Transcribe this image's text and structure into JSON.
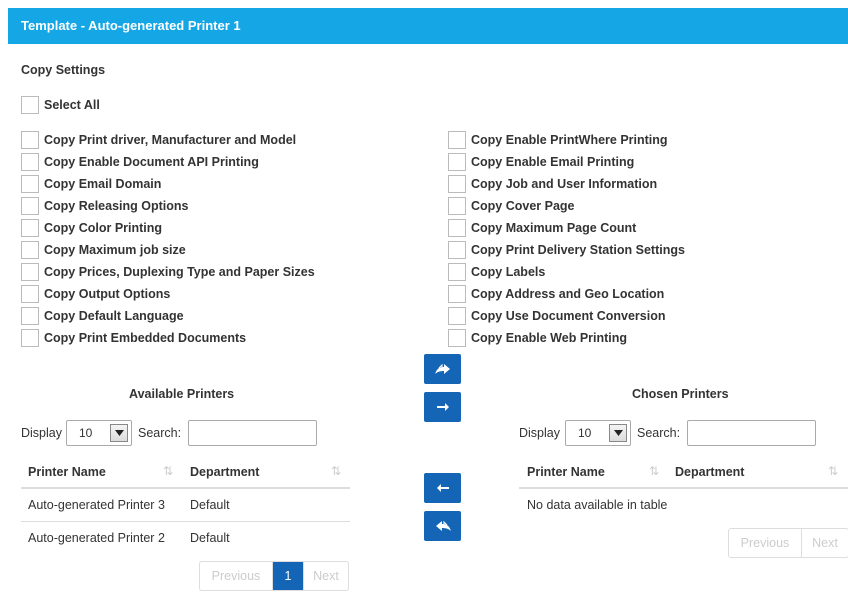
{
  "header": {
    "title": "Template - Auto-generated Printer 1"
  },
  "copy_settings": {
    "title": "Copy Settings",
    "select_all": "Select All",
    "left_options": [
      "Copy Print driver, Manufacturer and Model",
      "Copy Enable Document API Printing",
      "Copy Email Domain",
      "Copy Releasing Options",
      "Copy Color Printing",
      "Copy Maximum job size",
      "Copy Prices, Duplexing Type and Paper Sizes",
      "Copy Output Options",
      "Copy Default Language",
      "Copy Print Embedded Documents"
    ],
    "right_options": [
      "Copy Enable PrintWhere Printing",
      "Copy Enable Email Printing",
      "Copy Job and User Information",
      "Copy Cover Page",
      "Copy Maximum Page Count",
      "Copy Print Delivery Station Settings",
      "Copy Labels",
      "Copy Address and Geo Location",
      "Copy Use Document Conversion",
      "Copy Enable Web Printing"
    ]
  },
  "available": {
    "title": "Available Printers",
    "display_label": "Display",
    "display_value": "10",
    "search_label": "Search:",
    "search_value": "",
    "columns": [
      "Printer Name",
      "Department"
    ],
    "rows": [
      [
        "Auto-generated Printer 3",
        "Default"
      ],
      [
        "Auto-generated Printer 2",
        "Default"
      ]
    ],
    "pager": {
      "previous": "Previous",
      "page": "1",
      "next": "Next"
    }
  },
  "chosen": {
    "title": "Chosen Printers",
    "display_label": "Display",
    "display_value": "10",
    "search_label": "Search:",
    "search_value": "",
    "columns": [
      "Printer Name",
      "Department"
    ],
    "empty_text": "No data available in table",
    "pager": {
      "previous": "Previous",
      "next": "Next"
    }
  },
  "transfer_buttons": [
    "move-all-right",
    "move-right",
    "move-left",
    "move-all-left"
  ],
  "colors": {
    "header": "#15a6e6",
    "button": "#1565b7"
  }
}
